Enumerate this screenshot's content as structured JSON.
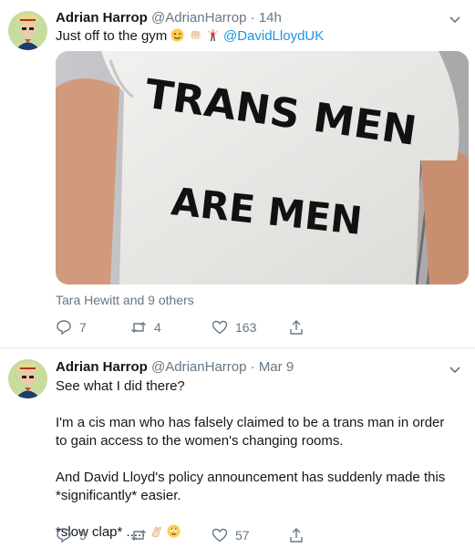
{
  "tweet1": {
    "author_name": "Adrian Harrop",
    "author_handle": "@AdrianHarrop",
    "separator": "·",
    "timestamp": "14h",
    "text": "Just off to the gym",
    "emojis": [
      "winking-face-icon",
      "fist-icon",
      "flexing-person-icon"
    ],
    "mention": "@DavidLloydUK",
    "photo_shirt_text": [
      "TRANS MEN",
      "ARE MEN"
    ],
    "liked_by": "Tara Hewitt and 9 others",
    "replies": "7",
    "retweets": "4",
    "likes": "163"
  },
  "tweet2": {
    "author_name": "Adrian Harrop",
    "author_handle": "@AdrianHarrop",
    "separator": "·",
    "timestamp": "Mar 9",
    "paragraphs": [
      "See what I did there?",
      "I'm a cis man who has falsely claimed to be a trans man in order to gain access to the women's changing rooms.",
      "And David Lloyd's policy announcement has suddenly made this *significantly* easier.",
      "*slow clap* ....."
    ],
    "emojis": [
      "clapping-hands-icon",
      "eye-roll-face-icon"
    ],
    "replies": "5",
    "retweets": "",
    "likes": "57"
  },
  "colors": {
    "text": "#14171a",
    "muted": "#657786",
    "link": "#1b95e0",
    "divider": "#e6ecf0"
  }
}
